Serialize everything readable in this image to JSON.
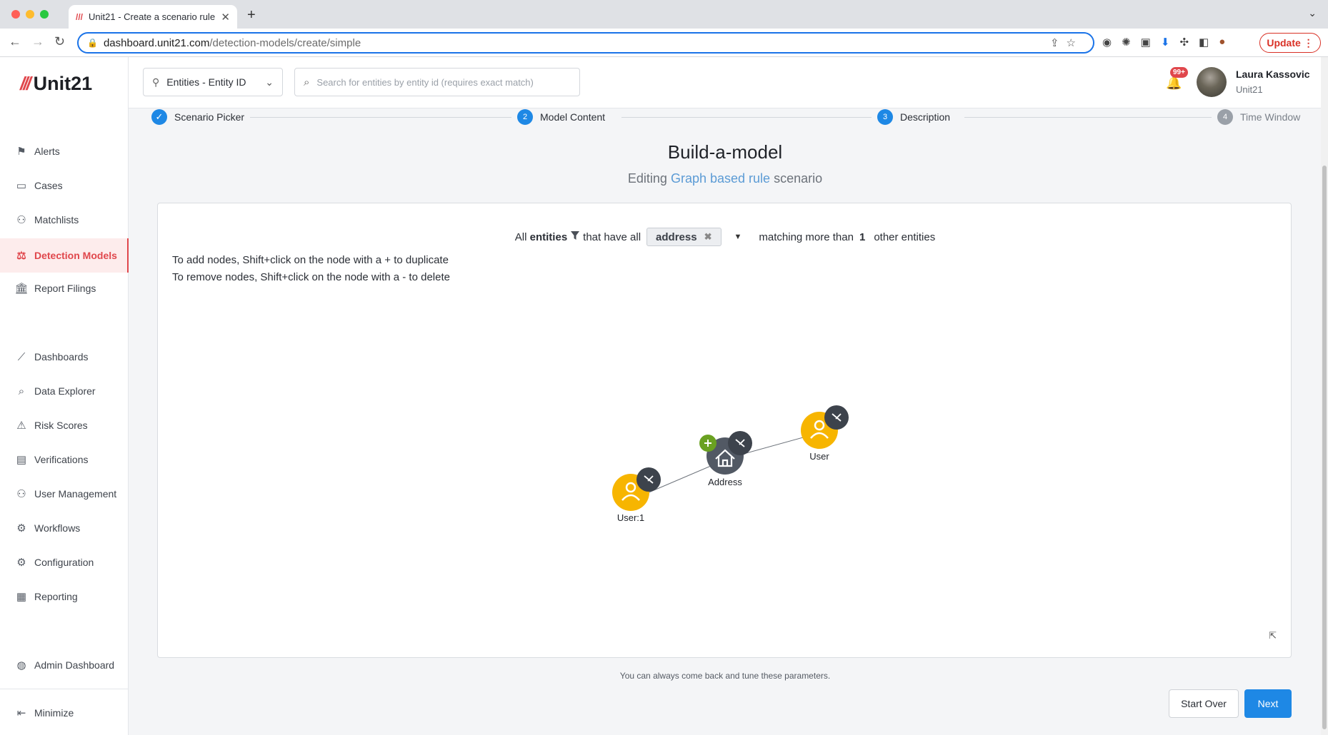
{
  "browser": {
    "tab_title": "Unit21 - Create a scenario rule",
    "url_host": "dashboard.unit21.com",
    "url_path": "/detection-models/create/simple",
    "update_label": "Update"
  },
  "brand": {
    "name": "Unit21"
  },
  "sidebar": {
    "items": [
      {
        "label": "Alerts",
        "icon": "flag-icon"
      },
      {
        "label": "Cases",
        "icon": "briefcase-icon"
      },
      {
        "label": "Matchlists",
        "icon": "user-x-icon"
      },
      {
        "label": "Detection Models",
        "icon": "scale-icon",
        "active": true
      },
      {
        "label": "Report Filings",
        "icon": "bank-icon"
      },
      {
        "label": "Dashboards",
        "icon": "chart-line-icon"
      },
      {
        "label": "Data Explorer",
        "icon": "search-table-icon"
      },
      {
        "label": "Risk Scores",
        "icon": "warning-icon"
      },
      {
        "label": "Verifications",
        "icon": "id-card-icon"
      },
      {
        "label": "User Management",
        "icon": "users-icon"
      },
      {
        "label": "Workflows",
        "icon": "workflow-icon"
      },
      {
        "label": "Configuration",
        "icon": "gear-icon"
      },
      {
        "label": "Reporting",
        "icon": "report-icon"
      },
      {
        "label": "Admin Dashboard",
        "icon": "globe-icon"
      }
    ],
    "minimize_label": "Minimize"
  },
  "topbar": {
    "entity_select_value": "Entities - Entity ID",
    "search_placeholder": "Search for entities by entity id (requires exact match)",
    "notification_count": "99+",
    "user_name": "Laura Kassovic",
    "user_org": "Unit21"
  },
  "stepper": {
    "steps": [
      {
        "number": "",
        "label": "Scenario Picker",
        "state": "done"
      },
      {
        "number": "2",
        "label": "Model Content",
        "state": "active"
      },
      {
        "number": "3",
        "label": "Description",
        "state": "active"
      },
      {
        "number": "4",
        "label": "Time Window",
        "state": "pending"
      }
    ]
  },
  "page": {
    "title": "Build-a-model",
    "subtitle_prefix": "Editing",
    "subtitle_link": "Graph based rule",
    "subtitle_suffix": "scenario"
  },
  "rule": {
    "all_label": "All",
    "entities_label": "entities",
    "that_have_all_label": "that have all",
    "attribute_chip": "address",
    "matching_label": "matching more than",
    "count": "1",
    "other_entities_label": "other entities"
  },
  "help": {
    "line1": "To add nodes, Shift+click on the node with a + to duplicate",
    "line2": "To remove nodes, Shift+click on the node with a - to delete"
  },
  "graph": {
    "nodes": [
      {
        "label": "User:1",
        "type": "user"
      },
      {
        "label": "Address",
        "type": "address"
      },
      {
        "label": "User",
        "type": "user"
      }
    ],
    "colors": {
      "user": "#f7b500",
      "address": "#525964",
      "badge": "#3d434c",
      "add": "#6aa121"
    }
  },
  "footer": {
    "hint": "You can always come back and tune these parameters.",
    "start_over_label": "Start Over",
    "next_label": "Next"
  },
  "colors": {
    "brand": "#e0474c",
    "primary": "#1e88e5",
    "step_done": "#1e88e5",
    "step_pending": "#9aa0a8"
  }
}
